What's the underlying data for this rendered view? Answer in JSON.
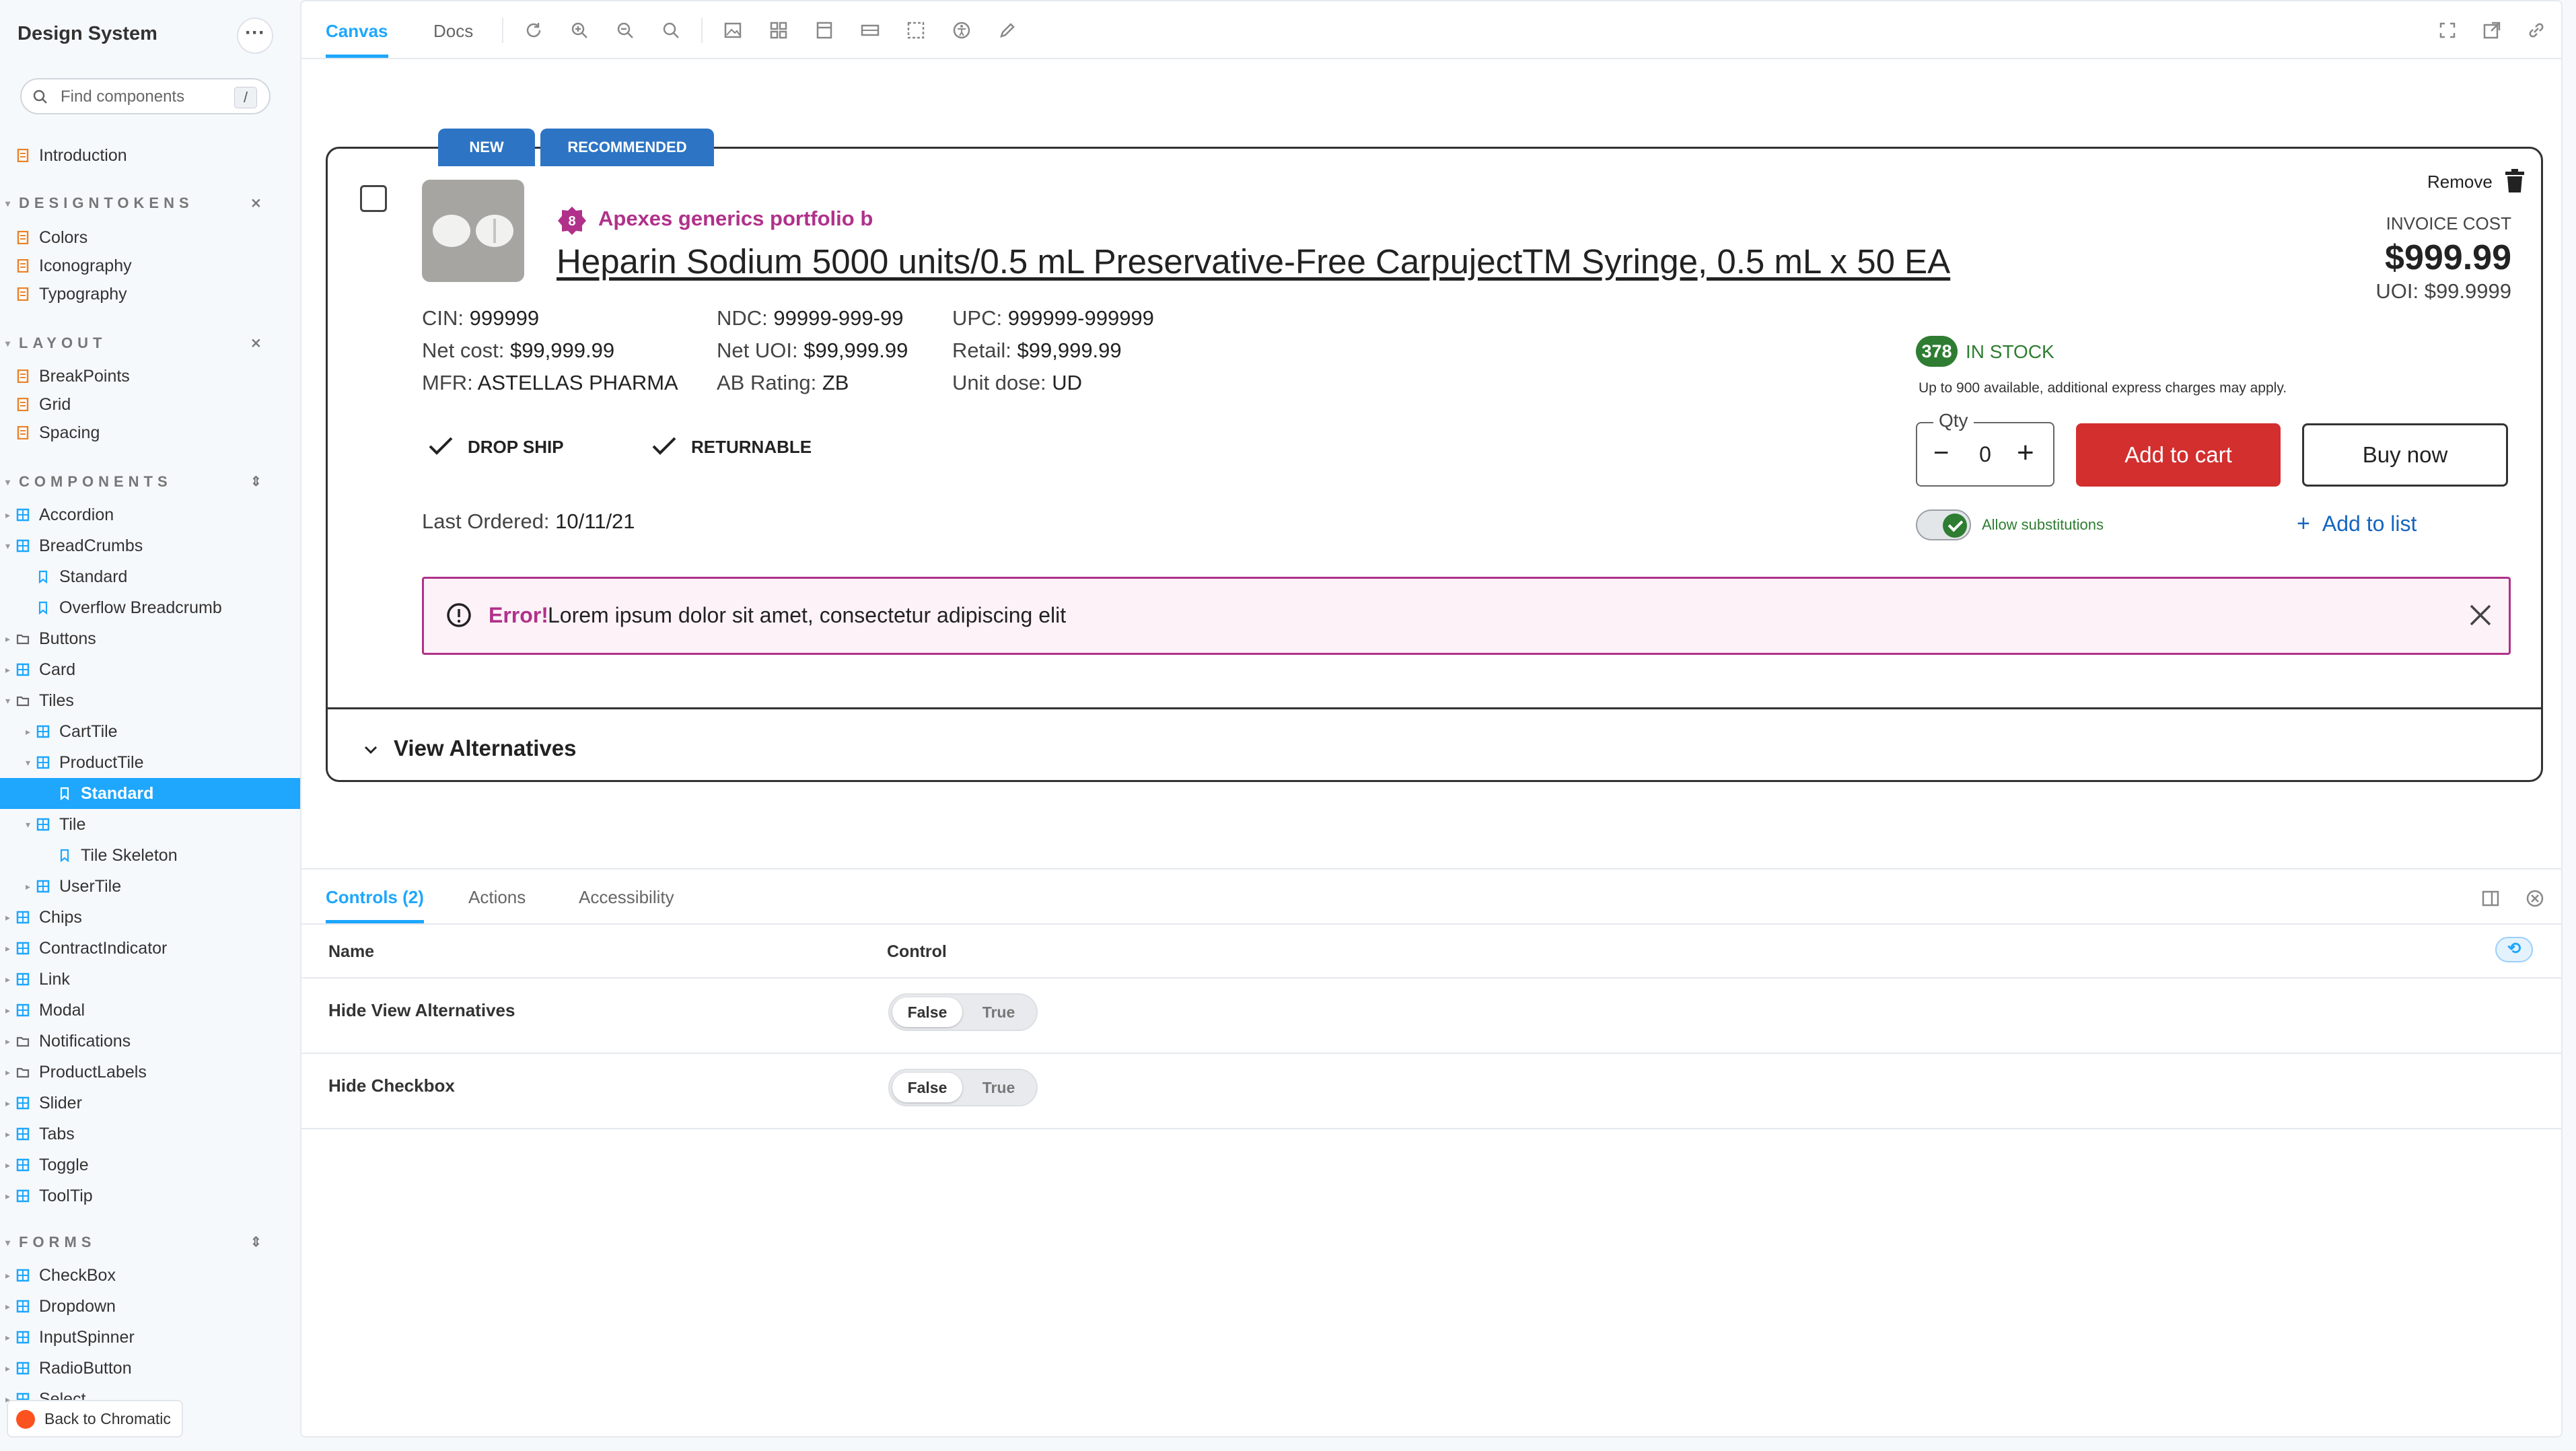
{
  "sidebar": {
    "title": "Design System",
    "search_placeholder": "Find components",
    "search_shortcut": "/",
    "introduction": "Introduction",
    "sections": {
      "designtokens": "DESIGNTOKENS",
      "layout": "LAYOUT",
      "components": "COMPONENTS",
      "forms": "FORMS"
    },
    "designtokens": [
      "Colors",
      "Iconography",
      "Typography"
    ],
    "layout": [
      "BreakPoints",
      "Grid",
      "Spacing"
    ],
    "components": [
      "Accordion",
      "BreadCrumbs",
      "Standard",
      "Overflow Breadcrumb",
      "Buttons",
      "Card",
      "Tiles",
      "CartTile",
      "ProductTile",
      "Standard",
      "Tile",
      "Tile Skeleton",
      "UserTile",
      "Chips",
      "ContractIndicator",
      "Link",
      "Modal",
      "Notifications",
      "ProductLabels",
      "Slider",
      "Tabs",
      "Toggle",
      "ToolTip"
    ],
    "forms": [
      "CheckBox",
      "Dropdown",
      "InputSpinner",
      "RadioButton",
      "Select"
    ],
    "back_label": "Back to Chromatic"
  },
  "toolbar": {
    "tabs": [
      "Canvas",
      "Docs"
    ]
  },
  "product": {
    "flags": [
      "NEW",
      "RECOMMENDED"
    ],
    "remove_label": "Remove",
    "portfolio_count": "8",
    "portfolio_name": "Apexes generics portfolio b",
    "title": "Heparin Sodium 5000 units/0.5 mL Preservative-Free CarpujectTM Syringe, 0.5 mL x 50 EA",
    "attrs": {
      "cin_label": "CIN:",
      "cin": "999999",
      "net_cost_label": "Net cost:",
      "net_cost": "$99,999.99",
      "mfr_label": "MFR:",
      "mfr": "ASTELLAS PHARMA",
      "ndc_label": "NDC:",
      "ndc": "99999-999-99",
      "net_uoi_label": "Net UOI:",
      "net_uoi": "$99,999.99",
      "ab_label": "AB Rating:",
      "ab": "ZB",
      "upc_label": "UPC:",
      "upc": "999999-999999",
      "retail_label": "Retail:",
      "retail": "$99,999.99",
      "unit_dose_label": "Unit dose:",
      "unit_dose": "UD"
    },
    "features": [
      "DROP SHIP",
      "RETURNABLE"
    ],
    "last_ordered_label": "Last Ordered:",
    "last_ordered": "10/11/21",
    "invoice_label": "INVOICE COST",
    "invoice_price": "$999.99",
    "uoi": "UOI: $99.9999",
    "stock_count": "378",
    "stock_label": "IN STOCK",
    "stock_note": "Up to 900 available, additional express charges may apply.",
    "qty_label": "Qty",
    "qty_value": "0",
    "add_to_cart": "Add to cart",
    "buy_now": "Buy now",
    "allow_substitutions": "Allow substitutions",
    "allow_substitutions_on": true,
    "add_to_list": "Add to list",
    "error_title": "Error!",
    "error_message": "Lorem ipsum dolor sit amet, consectetur adipiscing elit",
    "view_alternatives": "View Alternatives",
    "colors": {
      "flag": "#2d74c4",
      "brand": "#b0318a",
      "stock": "#2e7d32",
      "cart": "#d32f2f",
      "link": "#1565c0"
    }
  },
  "addons": {
    "tabs": [
      "Controls (2)",
      "Actions",
      "Accessibility"
    ],
    "col_name": "Name",
    "col_control": "Control",
    "rows": [
      {
        "name": "Hide View Alternatives",
        "options": [
          "False",
          "True"
        ],
        "selected": "False"
      },
      {
        "name": "Hide Checkbox",
        "options": [
          "False",
          "True"
        ],
        "selected": "False"
      }
    ]
  },
  "accent": "#1ea7fd"
}
